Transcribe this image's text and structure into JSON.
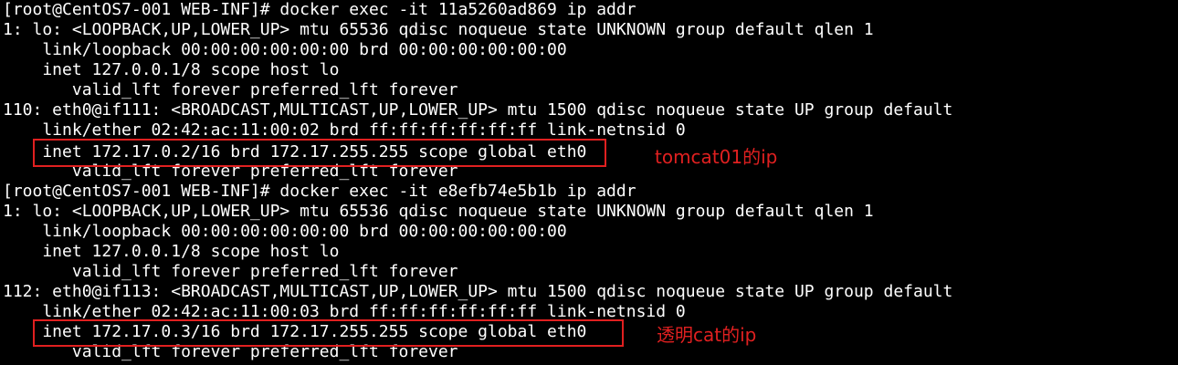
{
  "terminal": {
    "lines": [
      "[root@CentOS7-001 WEB-INF]# docker exec -it 11a5260ad869 ip addr",
      "1: lo: <LOOPBACK,UP,LOWER_UP> mtu 65536 qdisc noqueue state UNKNOWN group default qlen 1",
      "    link/loopback 00:00:00:00:00:00 brd 00:00:00:00:00:00",
      "    inet 127.0.0.1/8 scope host lo",
      "       valid_lft forever preferred_lft forever",
      "110: eth0@if111: <BROADCAST,MULTICAST,UP,LOWER_UP> mtu 1500 qdisc noqueue state UP group default",
      "    link/ether 02:42:ac:11:00:02 brd ff:ff:ff:ff:ff:ff link-netnsid 0",
      "    inet 172.17.0.2/16 brd 172.17.255.255 scope global eth0",
      "       valid_lft forever preferred_lft forever",
      "[root@CentOS7-001 WEB-INF]# docker exec -it e8efb74e5b1b ip addr",
      "1: lo: <LOOPBACK,UP,LOWER_UP> mtu 65536 qdisc noqueue state UNKNOWN group default qlen 1",
      "    link/loopback 00:00:00:00:00:00 brd 00:00:00:00:00:00",
      "    inet 127.0.0.1/8 scope host lo",
      "       valid_lft forever preferred_lft forever",
      "112: eth0@if113: <BROADCAST,MULTICAST,UP,LOWER_UP> mtu 1500 qdisc noqueue state UP group default",
      "    link/ether 02:42:ac:11:00:03 brd ff:ff:ff:ff:ff:ff link-netnsid 0",
      "    inet 172.17.0.3/16 brd 172.17.255.255 scope global eth0",
      "       valid_lft forever preferred_lft forever"
    ]
  },
  "annotations": {
    "first": "tomcat01的ip",
    "second": "透明cat的ip"
  },
  "colors": {
    "background": "#000000",
    "text": "#ffffff",
    "annotation": "#e02020"
  }
}
